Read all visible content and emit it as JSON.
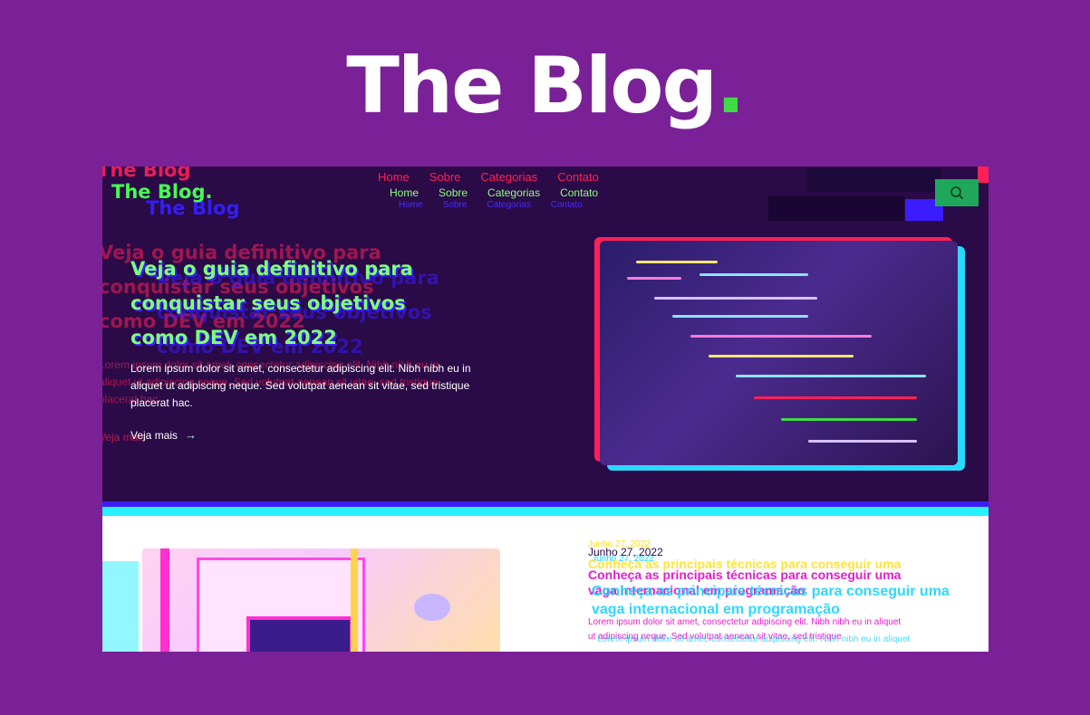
{
  "hero": {
    "title": "The Blog",
    "dot": "."
  },
  "site": {
    "logo": "The Blog.",
    "logo_ghost": "The Blog",
    "nav": [
      "Home",
      "Sobre",
      "Categorias",
      "Contato"
    ]
  },
  "featured": {
    "headline_lines": [
      "Veja o guia definitivo para",
      "conquistar seus objetivos",
      "como DEV em 2022"
    ],
    "lead_lines": [
      "Lorem ipsum dolor sit amet, consectetur adipiscing elit. Nibh nibh eu in",
      "aliquet ut adipiscing neque. Sed volutpat aenean sit vitae, sed tristique",
      "placerat hac."
    ],
    "cta": "Veja mais",
    "cta_icon": "arrow-right-icon"
  },
  "article": {
    "date": "Junho 27, 2022",
    "title_lines": [
      "Conheça as principais técnicas para conseguir uma",
      "vaga internacional em programação"
    ],
    "lead_lines": [
      "Lorem ipsum dolor sit amet, consectetur adipiscing elit. Nibh nibh eu in aliquet",
      "ut adipiscing neque. Sed volutpat aenean sit vitae, sed tristique"
    ]
  },
  "colors": {
    "background": "#7b2197",
    "accent_green": "#3ddc45",
    "site_dark": "#2a0a47",
    "glitch_red": "#ff2058",
    "glitch_blue": "#3a1cff",
    "glitch_cyan": "#27f0ff",
    "article_magenta": "#e21ecb"
  },
  "icons": {
    "search": "search-icon"
  }
}
